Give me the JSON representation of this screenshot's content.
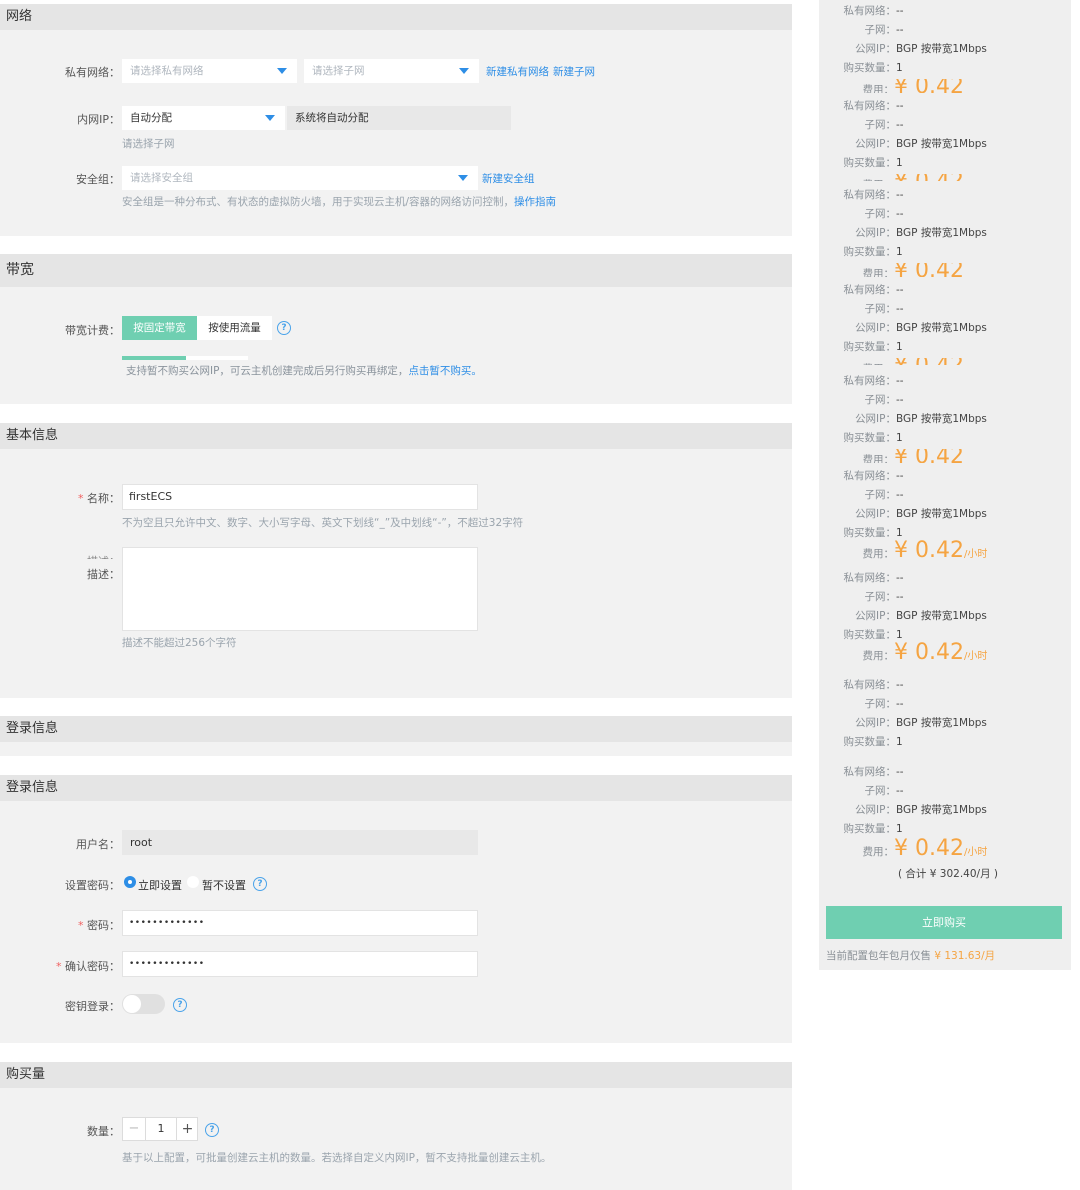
{
  "network": {
    "title": "网络",
    "vpc_label": "私有网络：",
    "vpc_placeholder": "请选择私有网络",
    "subnet_placeholder": "请选择子网",
    "new_vpc_link": "新建私有网络",
    "new_subnet_link": "新建子网",
    "ip_label": "内网IP：",
    "ip_value": "自动分配",
    "ip_note": "系统将自动分配",
    "ip_help": "请选择子网",
    "sg_label": "安全组：",
    "sg_placeholder": "请选择安全组",
    "new_sg_link": "新建安全组",
    "sg_help": "安全组是一种分布式、有状态的虚拟防火墙，用于实现云主机/容器的网络访问控制，",
    "sg_guide_link": "操作指南"
  },
  "bandwidth": {
    "title": "带宽",
    "billing_label": "带宽计费：",
    "opt_fixed": "按固定带宽",
    "opt_traffic": "按使用流量",
    "help_text": "支持暂不购买公网IP，可云主机创建完成后另行购买再绑定，",
    "help_link": "点击暂不购买。"
  },
  "basic": {
    "title": "基本信息",
    "name_label": "名称：",
    "name_value": "firstECS",
    "name_help": "不为空且只允许中文、数字、大小写字母、英文下划线“_”及中划线“-”，不超过32字符",
    "desc_label_ghost": "描述：",
    "desc_label": "描述：",
    "desc_help": "描述不能超过256个字符"
  },
  "login_collapsed": {
    "title": "登录信息"
  },
  "login": {
    "title": "登录信息",
    "user_label": "用户名：",
    "user_value": "root",
    "pwd_mode_label": "设置密码：",
    "pwd_now": "立即设置",
    "pwd_later": "暂不设置",
    "pwd_label": "密码：",
    "pwd_value": "•••••••••••••",
    "pwd2_label": "确认密码：",
    "pwd2_value": "•••••••••••••",
    "key_label": "密钥登录："
  },
  "purchase": {
    "title": "购买量",
    "qty_label": "数量：",
    "qty_value": "1",
    "minus": "−",
    "plus": "+",
    "help": "基于以上配置，可批量创建云主机的数量。若选择自定义内网IP，暂不支持批量创建云主机。"
  },
  "summary": {
    "k_vpc": "私有网络：",
    "k_subnet": "子网：",
    "k_ip": "公网IP：",
    "k_qty": "购买数量：",
    "k_fee": "费用：",
    "v_vpc": "--",
    "v_subnet": "--",
    "v_ip": "BGP 按带宽1Mbps",
    "v_qty": "1",
    "price": "¥ 0.42",
    "unit": "/小时",
    "total": "( 合计 ¥ 302.40/月 )",
    "buy_button": "立即购买",
    "annual_note": "当前配置包年包月仅售",
    "annual_price": "¥ 131.63/月"
  }
}
